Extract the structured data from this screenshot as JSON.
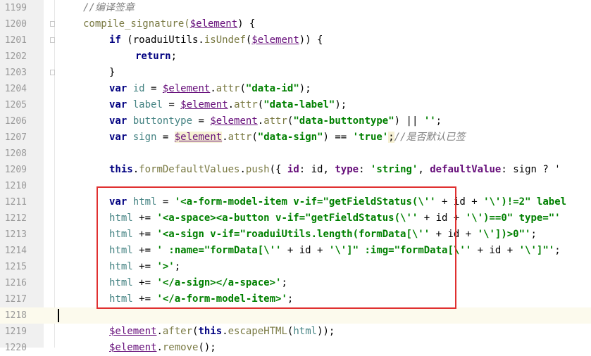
{
  "editor": {
    "lines": [
      {
        "num": "1199",
        "t": [
          "//编译签章"
        ]
      },
      {
        "num": "1200",
        "t": [
          "compile_signature(",
          "$element",
          ") {"
        ]
      },
      {
        "num": "1201",
        "t": [
          "if",
          " (roaduiUtils.",
          "isUndef",
          "(",
          "$element",
          ")) {"
        ]
      },
      {
        "num": "1202",
        "t": [
          "return",
          ";"
        ]
      },
      {
        "num": "1203",
        "t": [
          "}"
        ]
      },
      {
        "num": "1204",
        "t": [
          "var",
          " ",
          "id",
          " = ",
          "$element",
          ".",
          "attr",
          "(",
          "\"data-id\"",
          ");"
        ]
      },
      {
        "num": "1205",
        "t": [
          "var",
          " ",
          "label",
          " = ",
          "$element",
          ".",
          "attr",
          "(",
          "\"data-label\"",
          ");"
        ]
      },
      {
        "num": "1206",
        "t": [
          "var",
          " ",
          "buttontype",
          " = ",
          "$element",
          ".",
          "attr",
          "(",
          "\"data-buttontype\"",
          ") || ",
          "''",
          ";"
        ]
      },
      {
        "num": "1207",
        "t": [
          "var",
          " ",
          "sign",
          " = ",
          "$element",
          ".",
          "attr",
          "(",
          "\"data-sign\"",
          ") == ",
          "'true'",
          ";",
          "//是否默认已签"
        ]
      },
      {
        "num": "1208",
        "t": []
      },
      {
        "num": "1209",
        "t": [
          "this",
          ".",
          "formDefaultValues",
          ".",
          "push",
          "({ ",
          "id",
          ": id, ",
          "type",
          ": ",
          "'string'",
          ", ",
          "defaultValue",
          ": sign ? '"
        ]
      },
      {
        "num": "1210",
        "t": []
      },
      {
        "num": "1211",
        "t": [
          "var",
          " ",
          "html",
          " = ",
          "'<a-form-model-item v-if=\"getFieldStatus(\\''",
          " + id + ",
          "'\\')!=2\" label"
        ]
      },
      {
        "num": "1212",
        "t": [
          "html",
          " += ",
          "'<a-space><a-button v-if=\"getFieldStatus(\\''",
          " + id + ",
          "'\\')==0\" type=\"'"
        ]
      },
      {
        "num": "1213",
        "t": [
          "html",
          " += ",
          "'<a-sign v-if=\"roaduiUtils.length(formData[\\''",
          " + id + ",
          "'\\'])>0\"'",
          ";"
        ]
      },
      {
        "num": "1214",
        "t": [
          "html",
          " += ",
          "' :name=\"formData[\\''",
          " + id + ",
          "'\\']\" :img=\"formData[\\''",
          " + id + ",
          "'\\']\"'",
          ";"
        ]
      },
      {
        "num": "1215",
        "t": [
          "html",
          " += ",
          "'>'",
          ";"
        ]
      },
      {
        "num": "1216",
        "t": [
          "html",
          " += ",
          "'</a-sign></a-space>'",
          ";"
        ]
      },
      {
        "num": "1217",
        "t": [
          "html",
          " += ",
          "'</a-form-model-item>'",
          ";"
        ]
      },
      {
        "num": "1218",
        "t": []
      },
      {
        "num": "1219",
        "t": [
          "$element",
          ".",
          "after",
          "(",
          "this",
          ".",
          "escapeHTML",
          "(",
          "html",
          "));"
        ]
      },
      {
        "num": "1220",
        "t": [
          "$element",
          ".",
          "remove",
          "();"
        ]
      }
    ]
  },
  "colors": {
    "highlight_box": "#e03030",
    "keyword": "#000080",
    "string": "#008000",
    "comment": "#808080",
    "variable": "#660e7a"
  }
}
